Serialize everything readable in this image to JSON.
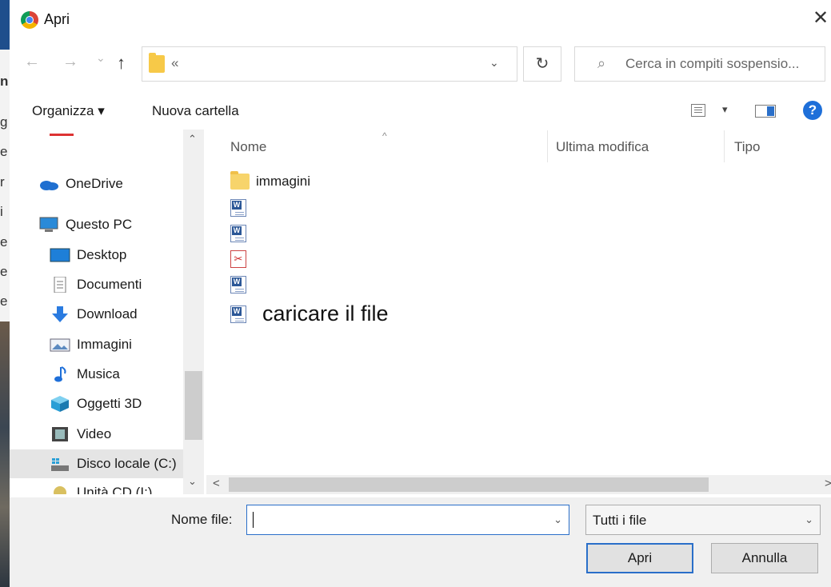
{
  "background_window": {
    "letters": [
      "n",
      "g",
      "e",
      "r",
      "i",
      "e",
      "e",
      "e"
    ]
  },
  "dialog": {
    "title": "Apri",
    "close_symbol": "✕"
  },
  "navigation": {
    "back": "←",
    "forward": "→",
    "recent": "⌄",
    "up": "↑",
    "address_text": "«",
    "address_dropdown": "⌄",
    "refresh": "↻",
    "search_icon": "⌕",
    "search_placeholder": "Cerca in compiti sospensio..."
  },
  "toolbar": {
    "organize_label": "Organizza ▾",
    "new_folder_label": "Nuova cartella",
    "view_dropdown": "▾",
    "help": "?"
  },
  "sidebar": {
    "scroll_up": "⌃",
    "scroll_down": "⌄",
    "items": [
      {
        "label": "OneDrive",
        "icon": "cloud-icon"
      },
      {
        "label": "Questo PC",
        "icon": "computer-icon"
      },
      {
        "label": "Desktop",
        "icon": "desktop-icon"
      },
      {
        "label": "Documenti",
        "icon": "documents-icon"
      },
      {
        "label": "Download",
        "icon": "download-icon"
      },
      {
        "label": "Immagini",
        "icon": "pictures-icon"
      },
      {
        "label": "Musica",
        "icon": "music-icon"
      },
      {
        "label": "Oggetti 3D",
        "icon": "objects-3d-icon"
      },
      {
        "label": "Video",
        "icon": "video-icon"
      },
      {
        "label": "Disco locale (C:)",
        "icon": "drive-icon",
        "selected": true
      },
      {
        "label": "Unità CD (I:)",
        "icon": "cd-drive-icon"
      }
    ]
  },
  "file_list": {
    "columns": [
      "Nome",
      "Ultima modifica",
      "Tipo"
    ],
    "sort_arrow": "^",
    "files": [
      {
        "name": "immagini",
        "type": "folder"
      },
      {
        "name": "",
        "type": "word"
      },
      {
        "name": "",
        "type": "word"
      },
      {
        "name": "",
        "type": "pdf"
      },
      {
        "name": "",
        "type": "word"
      },
      {
        "name": "",
        "type": "word"
      }
    ],
    "annotation": "caricare il file",
    "hscroll_left": "<",
    "hscroll_right": ">"
  },
  "bottom": {
    "filename_label": "Nome file:",
    "filename_value": "",
    "filename_dropdown": "⌄",
    "filter_value": "Tutti i file",
    "filter_dropdown": "⌄",
    "open_label": "Apri",
    "cancel_label": "Annulla"
  },
  "colors": {
    "accent": "#2a6fc9",
    "help_blue": "#1e6fd9",
    "folder_yellow": "#f7c948",
    "selected_bg": "#e5e5e5"
  }
}
